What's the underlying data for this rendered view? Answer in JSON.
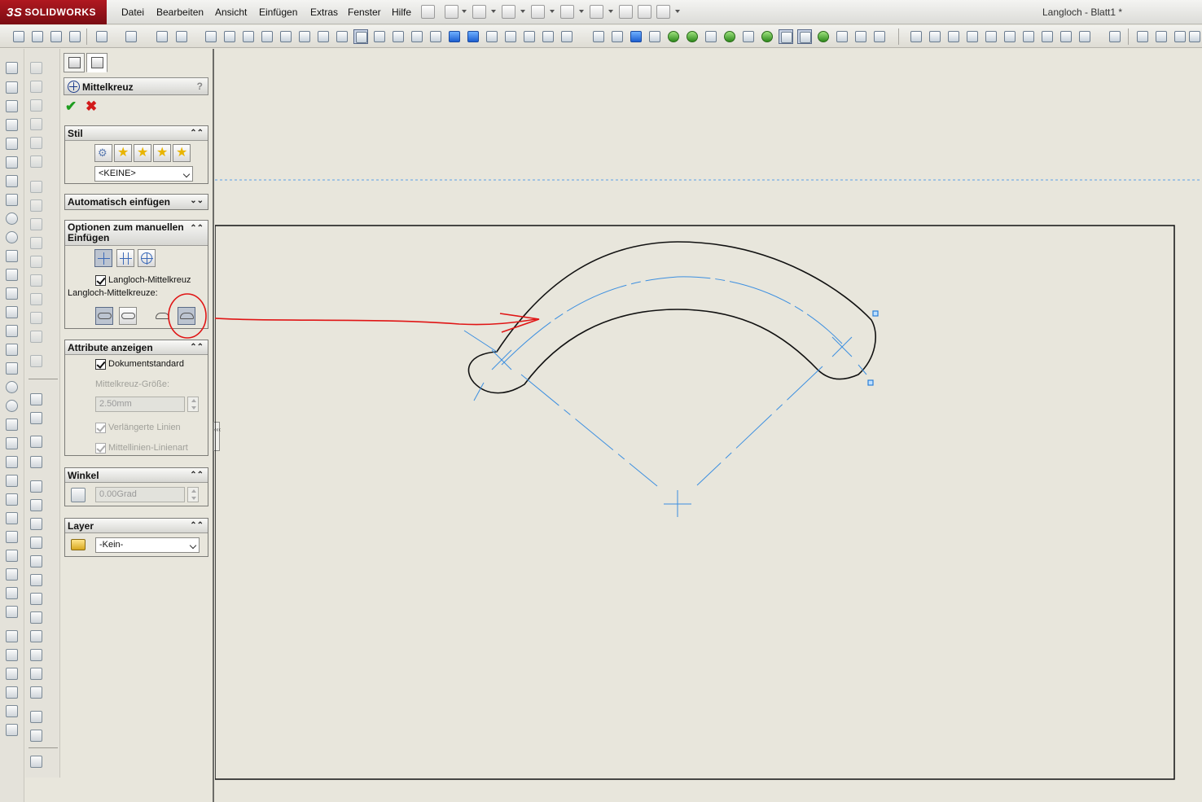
{
  "app": {
    "brand_ds": "3S",
    "brand_name": "SOLIDWORKS"
  },
  "menu": {
    "items": [
      "Datei",
      "Bearbeiten",
      "Ansicht",
      "Einfügen",
      "Extras",
      "Fenster",
      "Hilfe"
    ],
    "document_title": "Langloch - Blatt1 *"
  },
  "property_manager": {
    "title": "Mittelkreuz",
    "help": "?",
    "ok_symbol": "✔",
    "cancel_symbol": "✖",
    "groups": {
      "stil": {
        "title": "Stil",
        "style_select": "<KEINE>"
      },
      "auto": {
        "title": "Automatisch einfügen"
      },
      "manual": {
        "title": "Optionen zum manuellen Einfügen",
        "slot_checkbox_label": "Langloch-Mittelkreuz",
        "slot_checkbox_checked": true,
        "slot_types_label": "Langloch-Mittelkreuze:"
      },
      "attributes": {
        "title": "Attribute anzeigen",
        "doc_standard_label": "Dokumentstandard",
        "doc_standard_checked": true,
        "size_label": "Mittelkreuz-Größe:",
        "size_value": "2.50mm",
        "extended_lines_label": "Verlängerte Linien",
        "centerline_font_label": "Mittellinien-Linienart"
      },
      "angle": {
        "title": "Winkel",
        "value": "0.00Grad"
      },
      "layer": {
        "title": "Layer",
        "value": "-Kein-"
      }
    }
  },
  "colors": {
    "annotation_red": "#e01515",
    "centerline_blue": "#3c8fe0",
    "geometry_black": "#111111",
    "handle_blue": "#2a7fd8"
  }
}
